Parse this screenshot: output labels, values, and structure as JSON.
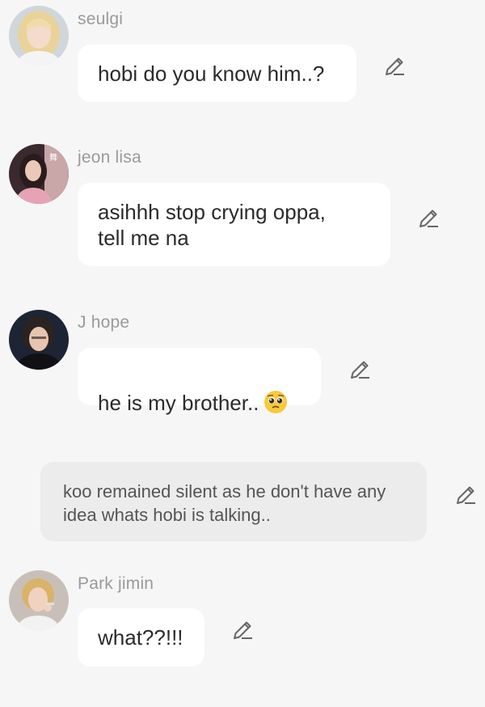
{
  "messages": [
    {
      "sender": "seulgi",
      "avatar": "avatar-seulgi",
      "text": "hobi do you know him..?"
    },
    {
      "sender": "jeon lisa",
      "avatar": "avatar-jeon-lisa",
      "text": "asihhh stop crying oppa,\ntell me na"
    },
    {
      "sender": "J hope",
      "avatar": "avatar-j-hope",
      "text": "he is my brother..",
      "emoji": "pleading-face-emoji"
    },
    {
      "sender": "Park jimin",
      "avatar": "avatar-park-jimin",
      "text": "what??!!!"
    }
  ],
  "narration": {
    "text": "koo remained silent as he don't have any idea whats hobi is talking.."
  },
  "icons": {
    "edit": "pencil-edit-icon"
  },
  "colors": {
    "background": "#f6f6f6",
    "bubble": "#ffffff",
    "narration_bubble": "#ececec",
    "sender_name": "#9a9a9a",
    "message_text": "#2b2b2b",
    "narration_text": "#555555",
    "icon": "#666666"
  }
}
